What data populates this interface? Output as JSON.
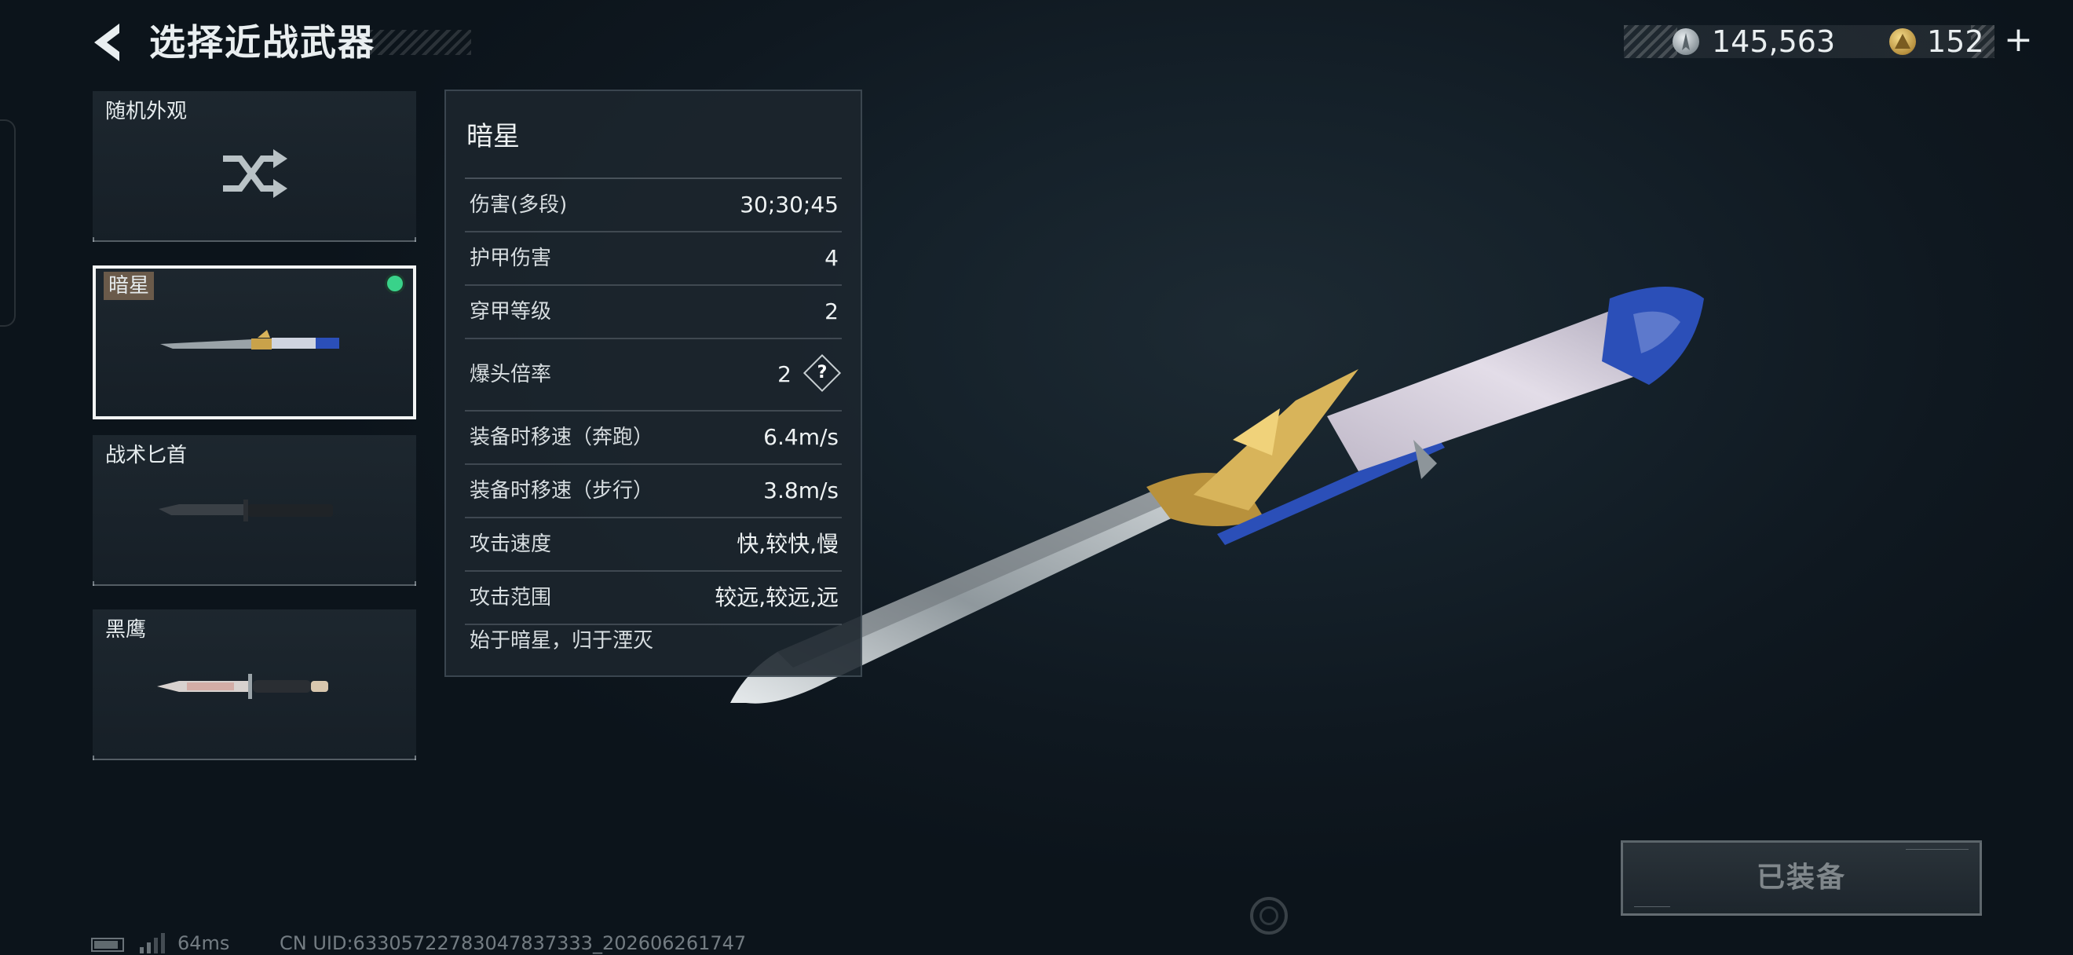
{
  "header": {
    "title": "选择近战武器",
    "currency_silver": "145,563",
    "currency_gold": "152",
    "plus": "+"
  },
  "weapon_list": [
    {
      "label": "随机外观",
      "icon": "shuffle-icon"
    },
    {
      "label": "暗星",
      "icon": "katana-icon",
      "selected": true,
      "equipped": true
    },
    {
      "label": "战术匕首",
      "icon": "combat-knife-icon"
    },
    {
      "label": "黑鹰",
      "icon": "black-eagle-knife-icon"
    }
  ],
  "details": {
    "name": "暗星",
    "stats": [
      {
        "name": "伤害(多段)",
        "value": "30;30;45"
      },
      {
        "name": "护甲伤害",
        "value": "4"
      },
      {
        "name": "穿甲等级",
        "value": "2"
      },
      {
        "name": "爆头倍率",
        "value": "2",
        "help": "?"
      },
      {
        "name": "装备时移速（奔跑）",
        "value": "6.4m/s"
      },
      {
        "name": "装备时移速（步行）",
        "value": "3.8m/s"
      },
      {
        "name": "攻击速度",
        "value": "快,较快,慢"
      },
      {
        "name": "攻击范围",
        "value": "较远,较远,远"
      }
    ],
    "lore": "始于暗星，归于湮灭"
  },
  "equip_button": {
    "label": "已装备"
  },
  "footer": {
    "ping": "64ms",
    "uid": "CN UID:63305722783047837333_202606261747"
  },
  "colors": {
    "equipped_dot": "#39d28a",
    "gold": "#c9a24a",
    "blue_hilt": "#2b4fb8"
  }
}
